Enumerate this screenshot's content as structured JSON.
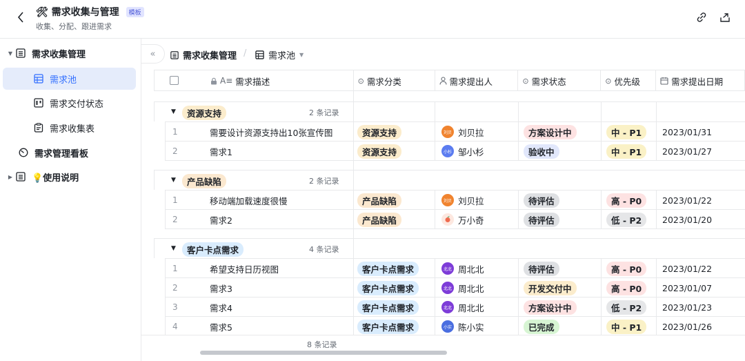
{
  "header": {
    "title": "🛠 需求收集与管理",
    "badge": "模板",
    "subtitle": "收集、分配、跟进需求"
  },
  "sidebar": {
    "items": [
      {
        "label": "需求收集管理"
      },
      {
        "label": "需求池"
      },
      {
        "label": "需求交付状态"
      },
      {
        "label": "需求收集表"
      },
      {
        "label": "需求管理看板"
      },
      {
        "label": "💡使用说明"
      }
    ]
  },
  "toolbar": {
    "crumb1": "需求收集管理",
    "crumb2": "需求池"
  },
  "table": {
    "columns": [
      "需求描述",
      "需求分类",
      "需求提出人",
      "需求状态",
      "优先级",
      "需求提出日期"
    ],
    "groups": [
      {
        "name": "资源支持",
        "count": "2 条记录",
        "rows": [
          {
            "idx": "1",
            "desc": "需要设计资源支持出10张宣传图",
            "category": "资源支持",
            "avatar": "刘贝",
            "person": "刘贝拉",
            "status": "方案设计中",
            "priority": "中 - P1",
            "date": "2023/01/31"
          },
          {
            "idx": "2",
            "desc": "需求1",
            "category": "资源支持",
            "avatar": "小杉",
            "person": "邹小杉",
            "status": "验收中",
            "priority": "中 - P1",
            "date": "2023/01/27"
          }
        ]
      },
      {
        "name": "产品缺陷",
        "count": "2 条记录",
        "rows": [
          {
            "idx": "1",
            "desc": "移动端加载速度很慢",
            "category": "产品缺陷",
            "avatar": "刘贝",
            "person": "刘贝拉",
            "status": "待评估",
            "priority": "高 - P0",
            "date": "2023/01/22"
          },
          {
            "idx": "2",
            "desc": "需求2",
            "category": "产品缺陷",
            "avatar": "",
            "person": "万小奇",
            "status": "待评估",
            "priority": "低 - P2",
            "date": "2023/01/20"
          }
        ]
      },
      {
        "name": "客户卡点需求",
        "count": "4 条记录",
        "rows": [
          {
            "idx": "1",
            "desc": "希望支持日历视图",
            "category": "客户卡点需求",
            "avatar": "北北",
            "person": "周北北",
            "status": "待评估",
            "priority": "高 - P0",
            "date": "2023/01/22"
          },
          {
            "idx": "2",
            "desc": "需求3",
            "category": "客户卡点需求",
            "avatar": "北北",
            "person": "周北北",
            "status": "开发交付中",
            "priority": "高 - P0",
            "date": "2023/01/07"
          },
          {
            "idx": "3",
            "desc": "需求4",
            "category": "客户卡点需求",
            "avatar": "北北",
            "person": "周北北",
            "status": "方案设计中",
            "priority": "低 - P2",
            "date": "2023/01/23"
          },
          {
            "idx": "4",
            "desc": "需求5",
            "category": "客户卡点需求",
            "avatar": "小实",
            "person": "陈小实",
            "status": "已完成",
            "priority": "中 - P1",
            "date": "2023/01/26"
          }
        ]
      }
    ],
    "total": "8 条记录"
  },
  "colors": {
    "accent": "#3370ff",
    "cat_resource": "#fbeccc",
    "cat_defect": "#fbe8cf",
    "cat_customer": "#d9ecfd",
    "status_design": "#fde2e2",
    "status_accept": "#e1e7fb",
    "status_eval": "#dee0e3",
    "status_dev": "#fbeccc",
    "status_done": "#d7f5d3",
    "prio_mid": "#faf1c6",
    "prio_high": "#fde2e2",
    "prio_low": "#e5e6e8"
  }
}
